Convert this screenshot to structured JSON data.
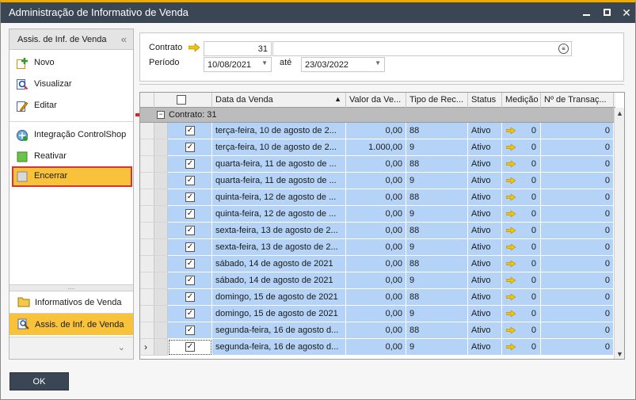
{
  "window": {
    "title": "Administração de Informativo de Venda",
    "controls": {
      "minimize": "minimize-icon",
      "maximize": "maximize-icon",
      "close": "✕"
    }
  },
  "sidebar": {
    "header": "Assis. de Inf. de Venda",
    "collapse_glyph": "«",
    "items": [
      {
        "label": "Novo",
        "icon": "add-icon"
      },
      {
        "label": "Visualizar",
        "icon": "view-icon"
      },
      {
        "label": "Editar",
        "icon": "edit-icon"
      },
      {
        "label": "Integração ControlShop",
        "icon": "integration-icon"
      },
      {
        "label": "Reativar",
        "icon": "reactivate-icon"
      },
      {
        "label": "Encerrar",
        "icon": "close-record-icon",
        "selected": true
      }
    ],
    "nav": [
      {
        "label": "Informativos de Venda",
        "icon": "folder-icon",
        "active": false
      },
      {
        "label": "Assis. de Inf. de Venda",
        "icon": "wizard-icon",
        "active": true
      }
    ],
    "more_glyph": "⌄"
  },
  "filter": {
    "contrato_label": "Contrato",
    "contrato_value": "31",
    "contrato_desc": "",
    "periodo_label": "Período",
    "periodo_from": "10/08/2021",
    "ate_label": "até",
    "periodo_to": "23/03/2022",
    "dropdown_glyph": "▼",
    "list_glyph": "≡"
  },
  "grid": {
    "columns": [
      "",
      "",
      "Data da Venda",
      "Valor da Ve...",
      "Tipo de Rec...",
      "Status",
      "Medição",
      "Nº de Transaç..."
    ],
    "sort_glyph": "▲",
    "group_label": "Contrato: 31",
    "group_glyph": "−",
    "check_glyph": "✓",
    "current_row_glyph": "›",
    "rows": [
      {
        "data": "terça-feira, 10 de agosto de 2...",
        "valor": "0,00",
        "tipo": "88",
        "status": "Ativo",
        "medicao": "0",
        "transacoes": "0"
      },
      {
        "data": "terça-feira, 10 de agosto de 2...",
        "valor": "1.000,00",
        "tipo": "9",
        "status": "Ativo",
        "medicao": "0",
        "transacoes": "0"
      },
      {
        "data": "quarta-feira, 11 de agosto de ...",
        "valor": "0,00",
        "tipo": "88",
        "status": "Ativo",
        "medicao": "0",
        "transacoes": "0"
      },
      {
        "data": "quarta-feira, 11 de agosto de ...",
        "valor": "0,00",
        "tipo": "9",
        "status": "Ativo",
        "medicao": "0",
        "transacoes": "0"
      },
      {
        "data": "quinta-feira, 12 de agosto de ...",
        "valor": "0,00",
        "tipo": "88",
        "status": "Ativo",
        "medicao": "0",
        "transacoes": "0"
      },
      {
        "data": "quinta-feira, 12 de agosto de ...",
        "valor": "0,00",
        "tipo": "9",
        "status": "Ativo",
        "medicao": "0",
        "transacoes": "0"
      },
      {
        "data": "sexta-feira, 13 de agosto de 2...",
        "valor": "0,00",
        "tipo": "88",
        "status": "Ativo",
        "medicao": "0",
        "transacoes": "0"
      },
      {
        "data": "sexta-feira, 13 de agosto de 2...",
        "valor": "0,00",
        "tipo": "9",
        "status": "Ativo",
        "medicao": "0",
        "transacoes": "0"
      },
      {
        "data": "sábado, 14 de agosto de 2021",
        "valor": "0,00",
        "tipo": "88",
        "status": "Ativo",
        "medicao": "0",
        "transacoes": "0"
      },
      {
        "data": "sábado, 14 de agosto de 2021",
        "valor": "0,00",
        "tipo": "9",
        "status": "Ativo",
        "medicao": "0",
        "transacoes": "0"
      },
      {
        "data": "domingo, 15 de agosto de 2021",
        "valor": "0,00",
        "tipo": "88",
        "status": "Ativo",
        "medicao": "0",
        "transacoes": "0"
      },
      {
        "data": "domingo, 15 de agosto de 2021",
        "valor": "0,00",
        "tipo": "9",
        "status": "Ativo",
        "medicao": "0",
        "transacoes": "0"
      },
      {
        "data": "segunda-feira, 16 de agosto d...",
        "valor": "0,00",
        "tipo": "88",
        "status": "Ativo",
        "medicao": "0",
        "transacoes": "0"
      },
      {
        "data": "segunda-feira, 16 de agosto d...",
        "valor": "0,00",
        "tipo": "9",
        "status": "Ativo",
        "medicao": "0",
        "transacoes": "0"
      }
    ],
    "scroll_up": "▲",
    "scroll_down": "▼"
  },
  "footer": {
    "ok_label": "OK"
  },
  "colors": {
    "titlebar": "#3a4654",
    "accent": "#f8c23a",
    "row_selected": "#b5d3f6",
    "highlight_border": "#e03030"
  }
}
